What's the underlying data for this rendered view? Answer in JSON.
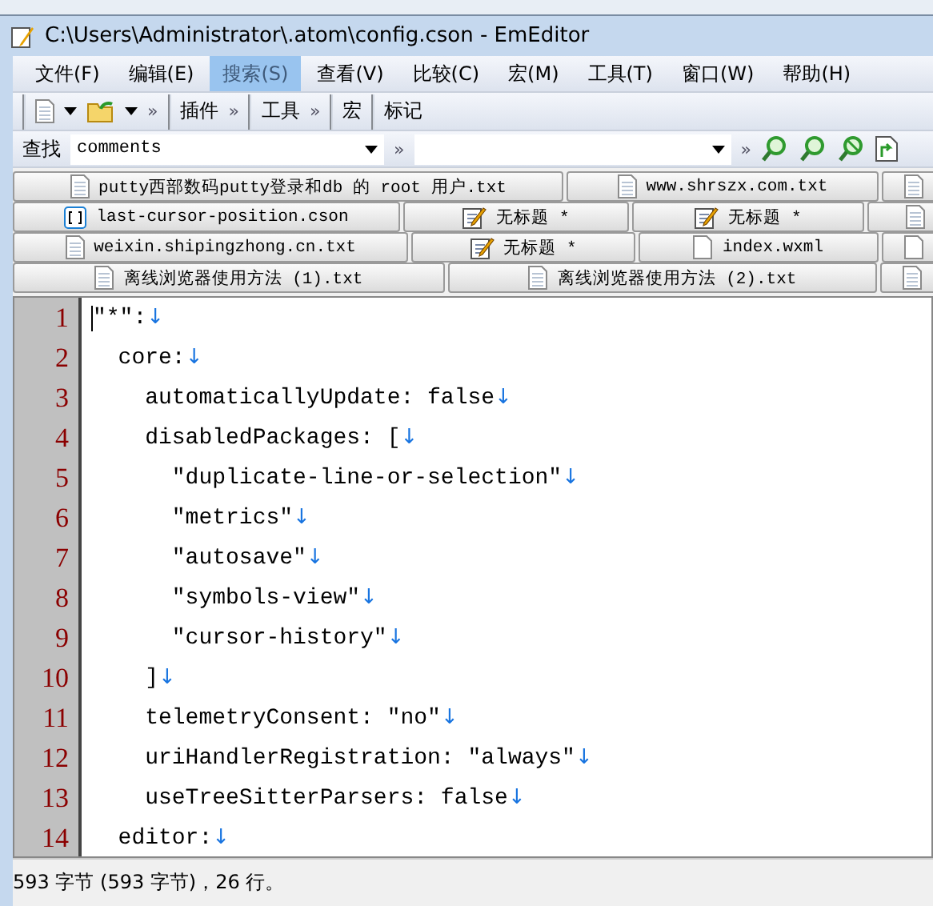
{
  "window": {
    "title": "C:\\Users\\Administrator\\.atom\\config.cson - EmEditor"
  },
  "menu": [
    {
      "label": "文件(F)",
      "selected": false
    },
    {
      "label": "编辑(E)",
      "selected": false
    },
    {
      "label": "搜索(S)",
      "selected": true
    },
    {
      "label": "查看(V)",
      "selected": false
    },
    {
      "label": "比较(C)",
      "selected": false
    },
    {
      "label": "宏(M)",
      "selected": false
    },
    {
      "label": "工具(T)",
      "selected": false
    },
    {
      "label": "窗口(W)",
      "selected": false
    },
    {
      "label": "帮助(H)",
      "selected": false
    }
  ],
  "toolbar": {
    "chevron": "»",
    "bands": [
      "插件",
      "工具",
      "宏",
      "标记"
    ]
  },
  "find_bar": {
    "label": "查找",
    "value": "comments",
    "chevron": "»"
  },
  "tab_rows": [
    [
      {
        "label": "putty西部数码putty登录和db 的 root 用户.txt",
        "kind": "text"
      },
      {
        "label": "www.shrszx.com.txt",
        "kind": "text"
      },
      {
        "kind": "text"
      }
    ],
    [
      {
        "label": "last-cursor-position.cson",
        "kind": "code"
      },
      {
        "label": "无标题 *",
        "kind": "edited"
      },
      {
        "label": "无标题 *",
        "kind": "edited"
      },
      {
        "kind": "text"
      }
    ],
    [
      {
        "label": "weixin.shipingzhong.cn.txt",
        "kind": "text"
      },
      {
        "label": "无标题 *",
        "kind": "edited"
      },
      {
        "label": "index.wxml",
        "kind": "blank"
      },
      {
        "kind": "blank"
      }
    ],
    [
      {
        "label": "离线浏览器使用方法 (1).txt",
        "kind": "text"
      },
      {
        "label": "离线浏览器使用方法 (2).txt",
        "kind": "text"
      },
      {
        "kind": "text"
      }
    ]
  ],
  "editor": {
    "lines": [
      {
        "number": "1",
        "text": "″*″:",
        "eol": "↓"
      },
      {
        "number": "2",
        "text": "  core:",
        "eol": "↓"
      },
      {
        "number": "3",
        "text": "    automaticallyUpdate: false",
        "eol": "↓"
      },
      {
        "number": "4",
        "text": "    disabledPackages: [",
        "eol": "↓"
      },
      {
        "number": "5",
        "text": "      ″duplicate-line-or-selection″",
        "eol": "↓"
      },
      {
        "number": "6",
        "text": "      ″metrics″",
        "eol": "↓"
      },
      {
        "number": "7",
        "text": "      ″autosave″",
        "eol": "↓"
      },
      {
        "number": "8",
        "text": "      ″symbols-view″",
        "eol": "↓"
      },
      {
        "number": "9",
        "text": "      ″cursor-history″",
        "eol": "↓"
      },
      {
        "number": "10",
        "text": "    ]",
        "eol": "↓"
      },
      {
        "number": "11",
        "text": "    telemetryConsent: ″no″",
        "eol": "↓"
      },
      {
        "number": "12",
        "text": "    uriHandlerRegistration: ″always″",
        "eol": "↓"
      },
      {
        "number": "13",
        "text": "    useTreeSitterParsers: false",
        "eol": "↓"
      },
      {
        "number": "14",
        "text": "  editor:",
        "eol": "↓"
      }
    ]
  },
  "status_bar": {
    "text": "593 字节 (593 字节)，26 行。"
  }
}
